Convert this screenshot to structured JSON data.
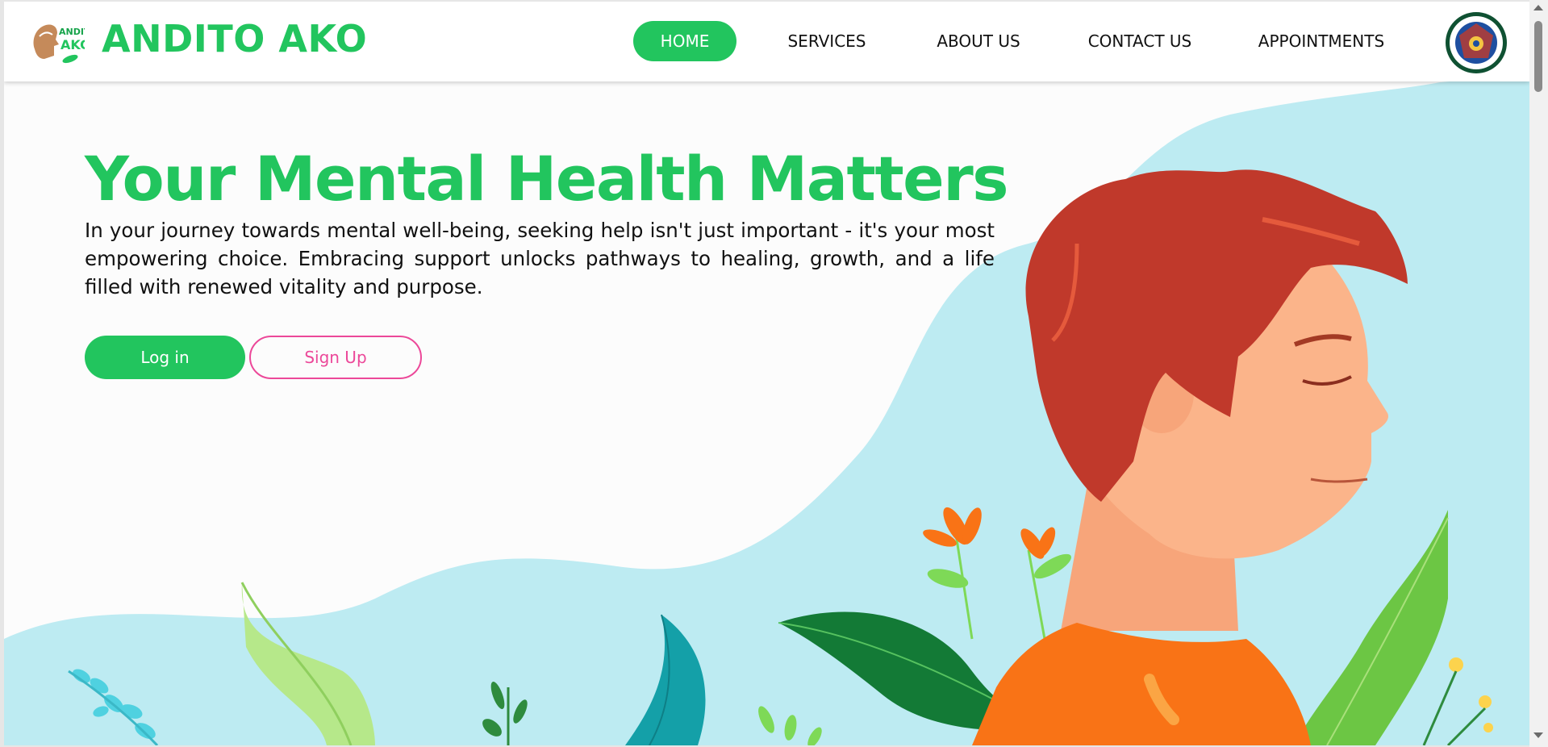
{
  "brand": {
    "name": "ANDITO AKO"
  },
  "nav": {
    "items": [
      {
        "label": "HOME",
        "active": true
      },
      {
        "label": "SERVICES",
        "active": false
      },
      {
        "label": "ABOUT US",
        "active": false
      },
      {
        "label": "CONTACT US",
        "active": false
      },
      {
        "label": "APPOINTMENTS",
        "active": false
      }
    ]
  },
  "hero": {
    "title": "Your Mental Health Matters",
    "description": "In your journey towards mental well-being, seeking help isn't just important - it's your most empowering choice. Embracing support unlocks pathways to healing, growth, and a life filled with renewed vitality and purpose.",
    "login_label": "Log in",
    "signup_label": "Sign Up"
  },
  "colors": {
    "accent": "#22c55e",
    "secondary": "#ec4899",
    "background_shape": "#bdebf2",
    "hair": "#c0392b",
    "skin": "#fbb48a",
    "shirt": "#f97316"
  },
  "icons": {
    "logo": "andito-ako-logo",
    "seal": "university-seal"
  }
}
